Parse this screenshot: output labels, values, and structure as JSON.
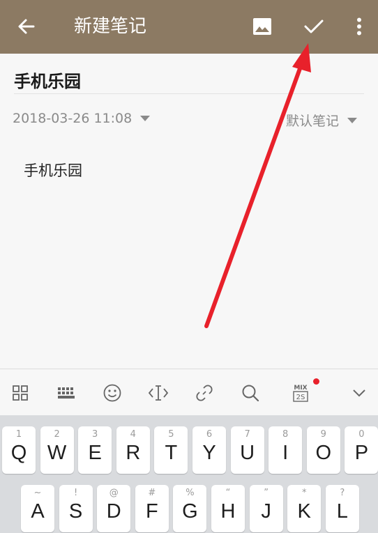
{
  "toolbar": {
    "title": "新建笔记",
    "back_icon": "arrow-left-icon",
    "image_icon": "image-icon",
    "confirm_icon": "check-icon",
    "more_icon": "more-vertical-icon",
    "background_color": "#8c7a63"
  },
  "note": {
    "title": "手机乐园",
    "date": "2018-03-26 11:08",
    "folder": "默认笔记",
    "body": "手机乐园"
  },
  "keyboard_toolbar": {
    "items": [
      "grid-icon",
      "keyboard-icon",
      "emoji-icon",
      "text-cursor-icon",
      "link-icon",
      "search-icon",
      "mix-2s-icon",
      "chevron-down-icon"
    ],
    "mix_label_top": "MIX",
    "mix_label_bottom": "2S",
    "notification_color": "#e8212b"
  },
  "keyboard": {
    "row1": [
      {
        "alt": "1",
        "key": "Q"
      },
      {
        "alt": "2",
        "key": "W"
      },
      {
        "alt": "3",
        "key": "E"
      },
      {
        "alt": "4",
        "key": "R"
      },
      {
        "alt": "5",
        "key": "T"
      },
      {
        "alt": "6",
        "key": "Y"
      },
      {
        "alt": "7",
        "key": "U"
      },
      {
        "alt": "8",
        "key": "I"
      },
      {
        "alt": "9",
        "key": "O"
      },
      {
        "alt": "0",
        "key": "P"
      }
    ],
    "row2": [
      {
        "alt": "~",
        "key": "A"
      },
      {
        "alt": "!",
        "key": "S"
      },
      {
        "alt": "@",
        "key": "D"
      },
      {
        "alt": "#",
        "key": "F"
      },
      {
        "alt": "%",
        "key": "G"
      },
      {
        "alt": "“",
        "key": "H"
      },
      {
        "alt": "”",
        "key": "J"
      },
      {
        "alt": "*",
        "key": "K"
      },
      {
        "alt": "?",
        "key": "L"
      }
    ]
  },
  "annotation": {
    "arrow_color": "#e8212b"
  }
}
